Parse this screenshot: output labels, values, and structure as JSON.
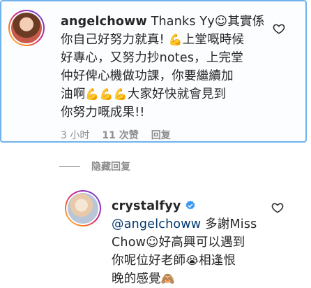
{
  "comment1": {
    "username": "angelchoww",
    "text_a": " Thanks Yy",
    "smile": "☺",
    "text_b": "其實係\n你自己好努力就真! ",
    "flex1": "💪",
    "text_c": "上堂嘅時候\n好專心，又努力抄notes，上完堂\n仲好俾心機做功課，你要繼續加\n油啊",
    "flex3": "💪💪💪",
    "text_d": "大家好快就會見到\n你努力嘅成果!!",
    "time": "3 小时",
    "likes": "11 次赞",
    "reply_label": "回复"
  },
  "hidden_replies_label": "隐藏回复",
  "comment2": {
    "username": "crystalfyy",
    "mention": "@angelchoww",
    "text_a": " 多謝Miss\nChow",
    "smile": "☺",
    "text_b": "好高興可以遇到\n你呢位好老師",
    "cry": "😭",
    "text_c": "相逢恨\n晚的感覺",
    "monkey": "🙈"
  },
  "icons": {
    "heart": "heart-outline-icon",
    "verified": "verified-badge-icon",
    "accent": "#6fb2ee",
    "verified_color": "#3897f0"
  }
}
